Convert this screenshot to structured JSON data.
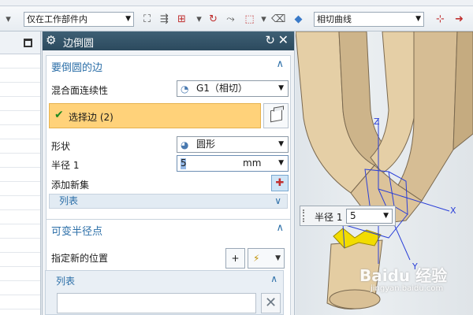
{
  "toolbar": {
    "filter_value": "仅在工作部件内",
    "curve_rule_value": "相切曲线"
  },
  "dialog": {
    "title": "边倒圆",
    "edges_group": {
      "title": "要倒圆的边",
      "blend_continuity_label": "混合面连续性",
      "blend_continuity_value": "G1（相切）",
      "select_edge_label": "选择边 (2)",
      "shape_label": "形状",
      "shape_value": "圆形",
      "radius_label": "半径 1",
      "radius_value": "5",
      "radius_unit": "mm",
      "add_new_set_label": "添加新集",
      "list_label": "列表"
    },
    "variable_group": {
      "title": "可变半径点",
      "specify_location_label": "指定新的位置",
      "list_label": "列表"
    }
  },
  "viewport": {
    "axis_labels": [
      "Z",
      "X",
      "Y"
    ],
    "radius_float_label": "半径 1",
    "radius_float_value": "5",
    "watermark": "Baidu 经验",
    "watermark_url": "jingyan.baidu.com"
  },
  "icons": {
    "title_icon": "gear-icon",
    "reset": "reset-icon",
    "close": "close-icon",
    "select_edge_check": "check-icon",
    "add_set": "add-set-icon",
    "delete": "delete-icon"
  }
}
